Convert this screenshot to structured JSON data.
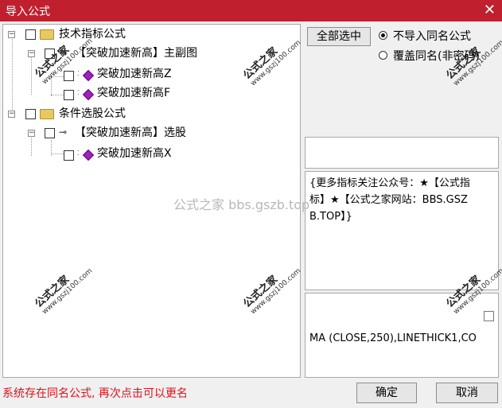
{
  "window": {
    "title": "导入公式",
    "close_glyph": "✕"
  },
  "tree": {
    "groups": [
      {
        "label": "技术指标公式",
        "children": [
          {
            "label": "【突破加速新高】主副图",
            "children": [
              "突破加速新高Z",
              "突破加速新高F"
            ]
          }
        ]
      },
      {
        "label": "条件选股公式",
        "children": [
          {
            "label": "【突破加速新高】选股",
            "children": [
              "突破加速新高X"
            ]
          }
        ]
      }
    ]
  },
  "options": {
    "select_all_label": "全部选中",
    "radio_skip_label": "不导入同名公式",
    "radio_overwrite_label": "覆盖同名(非密码)",
    "selected": "skip"
  },
  "description": {
    "text": "{更多指标关注公众号：★【公式指标】★【公式之家网站：BBS.GSZB.TOP】}"
  },
  "formula": {
    "text": "MA (CLOSE,250),LINETHICK1,CO"
  },
  "status": {
    "message": "系统存在同名公式, 再次点击可以更名"
  },
  "buttons": {
    "ok_label": "确定",
    "cancel_label": "取消"
  },
  "watermark": {
    "center_text": "公式之家 bbs.gszb.top",
    "stamp_title": "公式之家",
    "stamp_url": "www.gszj100.com"
  }
}
